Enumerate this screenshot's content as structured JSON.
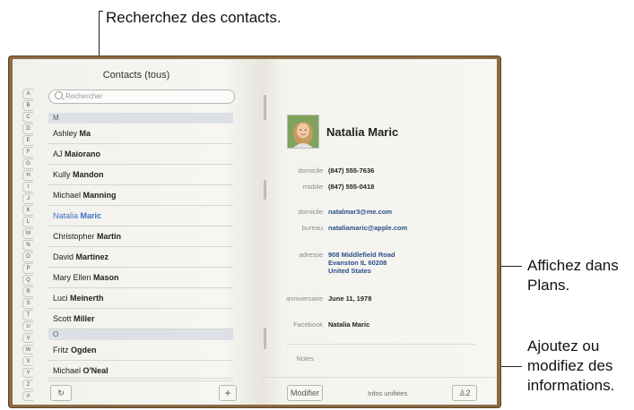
{
  "callouts": {
    "search": "Recherchez des contacts.",
    "maps": [
      "Affichez dans",
      "Plans."
    ],
    "edit": [
      "Ajoutez ou",
      "modifiez des",
      "informations."
    ]
  },
  "left_page": {
    "title": "Contacts (tous)",
    "search_placeholder": "Rechercher",
    "index": [
      "A",
      "B",
      "C",
      "D",
      "E",
      "F",
      "G",
      "H",
      "I",
      "J",
      "K",
      "L",
      "M",
      "N",
      "O",
      "P",
      "Q",
      "R",
      "S",
      "T",
      "U",
      "V",
      "W",
      "X",
      "Y",
      "Z",
      "#"
    ],
    "sections": [
      {
        "letter": "M",
        "rows": [
          {
            "first": "Ashley",
            "last": "Ma"
          },
          {
            "first": "AJ",
            "last": "Maiorano"
          },
          {
            "first": "Kully",
            "last": "Mandon"
          },
          {
            "first": "Michael",
            "last": "Manning"
          },
          {
            "first": "Natalia",
            "last": "Maric",
            "selected": true
          },
          {
            "first": "Christopher",
            "last": "Martin"
          },
          {
            "first": "David",
            "last": "Martinez"
          },
          {
            "first": "Mary Ellen",
            "last": "Mason"
          },
          {
            "first": "Luci",
            "last": "Meinerth"
          },
          {
            "first": "Scott",
            "last": "Miller"
          }
        ]
      },
      {
        "letter": "O",
        "rows": [
          {
            "first": "Fritz",
            "last": "Ogden"
          },
          {
            "first": "Michael",
            "last": "O'Neal"
          }
        ]
      }
    ],
    "add_label": "+",
    "refresh_icon": "refresh-icon"
  },
  "right_page": {
    "name": "Natalia Maric",
    "home_label": "domicile",
    "home_phone": "(847) 555-7636",
    "mobile_label": "mobile",
    "mobile_phone": "(847) 555-0418",
    "home_email_label": "domicile",
    "home_email": "natalmar3@me.com",
    "work_email_label": "bureau",
    "work_email": "nataliamaric@apple.com",
    "address_label": "adresse",
    "address_line1": "908 Middlefield Road",
    "address_line2": "Evanston IL 60208",
    "address_line3": "United States",
    "birthday_label": "anniversaire",
    "birthday": "June 11, 1978",
    "facebook_label": "Facebook",
    "facebook": "Natalia Maric",
    "notes_label": "Notes",
    "modify_label": "Modifier",
    "unified_label": "Infos unifiées",
    "linked_count": "2"
  },
  "colors": {
    "selected": "#3b6fc4",
    "book_cover": "#8e6a42",
    "link": "#2d4f8a"
  }
}
